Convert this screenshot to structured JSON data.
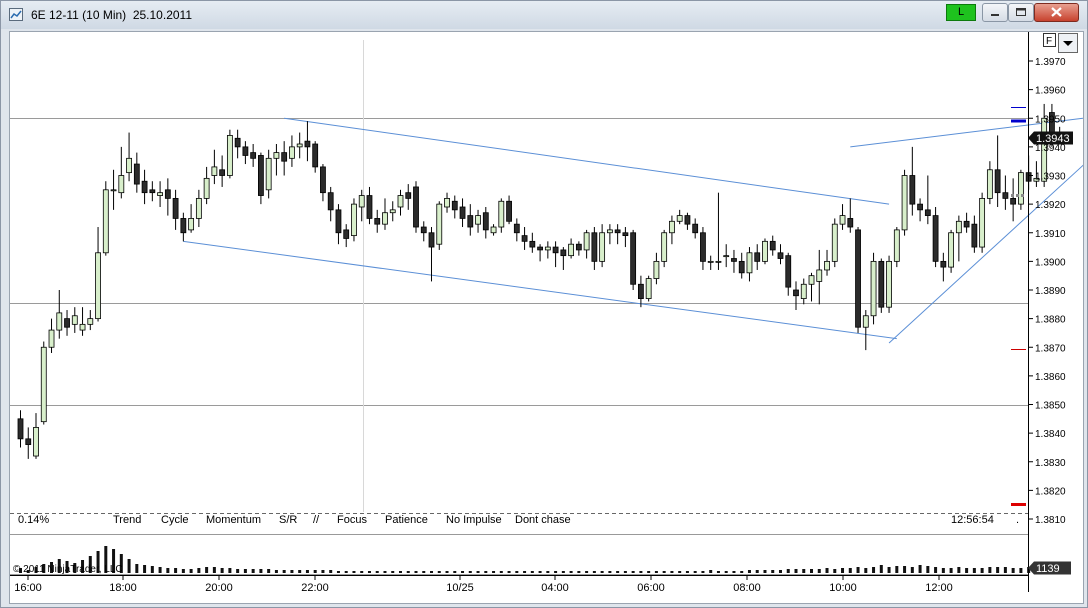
{
  "window": {
    "title": "6E 12-11 (10 Min)  25.10.2011",
    "l_button_label": "L",
    "f_button_label": "F"
  },
  "price_tag": "1.3943",
  "volume_tag": "1139",
  "percent_label": "0.14%",
  "time_readout": "12:56:54",
  "copyright": "© 2011 NinjaTrader, LLC",
  "checklist": [
    "Trend",
    "Cycle",
    "Momentum",
    "S/R",
    "//",
    "Focus",
    "Patience",
    "No Impulse",
    "Dont chase"
  ],
  "chart_data": {
    "type": "candlestick",
    "instrument": "6E 12-11",
    "interval": "10 Min",
    "date": "25.10.2011",
    "y_ticks": [
      "1.3970",
      "1.3960",
      "1.3950",
      "1.3940",
      "1.3930",
      "1.3920",
      "1.3910",
      "1.3900",
      "1.3890",
      "1.3880",
      "1.3870",
      "1.3860",
      "1.3850",
      "1.3840",
      "1.3830",
      "1.3820",
      "1.3810"
    ],
    "x_ticks": [
      "16:00",
      "18:00",
      "20:00",
      "22:00",
      "10/25",
      "04:00",
      "06:00",
      "08:00",
      "10:00",
      "12:00"
    ],
    "ylim": [
      1.3805,
      1.3983
    ],
    "last_price": 1.3943,
    "horizontal_lines": [
      1.395,
      1.38855,
      1.385
    ],
    "candles": [
      [
        1.3845,
        1.3838,
        1.3848,
        1.3835
      ],
      [
        1.3838,
        1.3836,
        1.3842,
        1.3831
      ],
      [
        1.3832,
        1.3842,
        1.3847,
        1.3831
      ],
      [
        1.3844,
        1.387,
        1.3872,
        1.3843
      ],
      [
        1.387,
        1.3876,
        1.388,
        1.3868
      ],
      [
        1.3876,
        1.3882,
        1.389,
        1.3873
      ],
      [
        1.388,
        1.3877,
        1.3883,
        1.3874
      ],
      [
        1.3878,
        1.3881,
        1.3884,
        1.3875
      ],
      [
        1.3876,
        1.3878,
        1.3884,
        1.3874
      ],
      [
        1.3878,
        1.388,
        1.3883,
        1.3876
      ],
      [
        1.388,
        1.3903,
        1.3912,
        1.3879
      ],
      [
        1.3903,
        1.3925,
        1.3928,
        1.3902
      ],
      [
        1.3925,
        1.3925,
        1.3932,
        1.3918
      ],
      [
        1.3924,
        1.393,
        1.394,
        1.3922
      ],
      [
        1.3931,
        1.3936,
        1.3945,
        1.3928
      ],
      [
        1.3934,
        1.3927,
        1.3938,
        1.3924
      ],
      [
        1.3928,
        1.3924,
        1.3932,
        1.392
      ],
      [
        1.3925,
        1.3924,
        1.3928,
        1.3921
      ],
      [
        1.3923,
        1.3924,
        1.3928,
        1.3919
      ],
      [
        1.3925,
        1.3922,
        1.3929,
        1.3916
      ],
      [
        1.3922,
        1.3915,
        1.3925,
        1.3911
      ],
      [
        1.3915,
        1.391,
        1.3917,
        1.3907
      ],
      [
        1.3911,
        1.3915,
        1.392,
        1.391
      ],
      [
        1.3915,
        1.3922,
        1.3925,
        1.3912
      ],
      [
        1.3922,
        1.3929,
        1.3933,
        1.392
      ],
      [
        1.393,
        1.3933,
        1.3939,
        1.3927
      ],
      [
        1.3932,
        1.393,
        1.3937,
        1.3926
      ],
      [
        1.393,
        1.3944,
        1.3946,
        1.3929
      ],
      [
        1.3943,
        1.394,
        1.3946,
        1.3936
      ],
      [
        1.394,
        1.3937,
        1.3942,
        1.3934
      ],
      [
        1.3938,
        1.3936,
        1.3941,
        1.3933
      ],
      [
        1.3937,
        1.3923,
        1.3938,
        1.392
      ],
      [
        1.3925,
        1.3936,
        1.3939,
        1.3922
      ],
      [
        1.3936,
        1.3938,
        1.3941,
        1.393
      ],
      [
        1.3938,
        1.3935,
        1.3942,
        1.393
      ],
      [
        1.3936,
        1.394,
        1.3944,
        1.3933
      ],
      [
        1.394,
        1.3941,
        1.3945,
        1.3936
      ],
      [
        1.3942,
        1.394,
        1.3949,
        1.3935
      ],
      [
        1.3941,
        1.3933,
        1.3942,
        1.3931
      ],
      [
        1.3933,
        1.3924,
        1.3934,
        1.3921
      ],
      [
        1.3924,
        1.3918,
        1.3926,
        1.3914
      ],
      [
        1.3918,
        1.391,
        1.392,
        1.3906
      ],
      [
        1.3911,
        1.3908,
        1.3913,
        1.3905
      ],
      [
        1.3909,
        1.392,
        1.3922,
        1.3907
      ],
      [
        1.3919,
        1.3923,
        1.3925,
        1.3914
      ],
      [
        1.3923,
        1.3915,
        1.3926,
        1.3913
      ],
      [
        1.3915,
        1.3913,
        1.3918,
        1.391
      ],
      [
        1.3913,
        1.3917,
        1.3922,
        1.3911
      ],
      [
        1.3917,
        1.3918,
        1.3921,
        1.3914
      ],
      [
        1.3919,
        1.3923,
        1.3925,
        1.3916
      ],
      [
        1.3924,
        1.3922,
        1.3927,
        1.3918
      ],
      [
        1.3926,
        1.3912,
        1.3928,
        1.391
      ],
      [
        1.3912,
        1.391,
        1.3914,
        1.3907
      ],
      [
        1.391,
        1.3905,
        1.3912,
        1.3893
      ],
      [
        1.3906,
        1.392,
        1.3921,
        1.3904
      ],
      [
        1.3919,
        1.3922,
        1.3924,
        1.3917
      ],
      [
        1.3921,
        1.3918,
        1.3923,
        1.3915
      ],
      [
        1.3919,
        1.3915,
        1.3922,
        1.3912
      ],
      [
        1.3916,
        1.3912,
        1.392,
        1.3909
      ],
      [
        1.3913,
        1.3916,
        1.3918,
        1.391
      ],
      [
        1.3917,
        1.3911,
        1.3919,
        1.3908
      ],
      [
        1.391,
        1.3912,
        1.3913,
        1.3909
      ],
      [
        1.3912,
        1.3921,
        1.3922,
        1.391
      ],
      [
        1.3921,
        1.3914,
        1.3923,
        1.3913
      ],
      [
        1.3913,
        1.391,
        1.3915,
        1.3907
      ],
      [
        1.3909,
        1.3907,
        1.3912,
        1.3904
      ],
      [
        1.3907,
        1.3905,
        1.391,
        1.3903
      ],
      [
        1.3905,
        1.3904,
        1.3906,
        1.39
      ],
      [
        1.3904,
        1.3905,
        1.3907,
        1.3901
      ],
      [
        1.3905,
        1.3903,
        1.3907,
        1.3898
      ],
      [
        1.3904,
        1.3902,
        1.3905,
        1.3897
      ],
      [
        1.3902,
        1.3906,
        1.3908,
        1.3901
      ],
      [
        1.3906,
        1.3904,
        1.3907,
        1.3902
      ],
      [
        1.3904,
        1.391,
        1.3911,
        1.3901
      ],
      [
        1.391,
        1.39,
        1.3912,
        1.3897
      ],
      [
        1.39,
        1.391,
        1.3913,
        1.3898
      ],
      [
        1.391,
        1.3911,
        1.3913,
        1.3906
      ],
      [
        1.3911,
        1.391,
        1.3913,
        1.3906
      ],
      [
        1.391,
        1.3909,
        1.3912,
        1.3905
      ],
      [
        1.391,
        1.3892,
        1.3911,
        1.389
      ],
      [
        1.3892,
        1.3887,
        1.3895,
        1.3884
      ],
      [
        1.3887,
        1.3894,
        1.3895,
        1.3886
      ],
      [
        1.3894,
        1.39,
        1.3903,
        1.3892
      ],
      [
        1.39,
        1.391,
        1.3911,
        1.3898
      ],
      [
        1.391,
        1.3914,
        1.3916,
        1.3906
      ],
      [
        1.3914,
        1.3916,
        1.3918,
        1.3913
      ],
      [
        1.3916,
        1.3913,
        1.3917,
        1.3911
      ],
      [
        1.3913,
        1.391,
        1.3915,
        1.3908
      ],
      [
        1.391,
        1.39,
        1.3912,
        1.3897
      ],
      [
        1.39,
        1.39,
        1.3902,
        1.3897
      ],
      [
        1.39,
        1.39,
        1.3924,
        1.3897
      ],
      [
        1.3902,
        1.3902,
        1.3906,
        1.3898
      ],
      [
        1.3901,
        1.39,
        1.3904,
        1.3896
      ],
      [
        1.39,
        1.3896,
        1.3903,
        1.3894
      ],
      [
        1.3896,
        1.3903,
        1.3905,
        1.3893
      ],
      [
        1.3903,
        1.39,
        1.3906,
        1.3897
      ],
      [
        1.39,
        1.3907,
        1.3908,
        1.3899
      ],
      [
        1.3907,
        1.3904,
        1.3909,
        1.3902
      ],
      [
        1.3903,
        1.3901,
        1.3906,
        1.3899
      ],
      [
        1.3902,
        1.3891,
        1.3903,
        1.3888
      ],
      [
        1.389,
        1.3888,
        1.3893,
        1.3883
      ],
      [
        1.3887,
        1.3892,
        1.3894,
        1.3885
      ],
      [
        1.3892,
        1.3895,
        1.3896,
        1.3886
      ],
      [
        1.3893,
        1.3897,
        1.3904,
        1.3885
      ],
      [
        1.3897,
        1.39,
        1.3904,
        1.3895
      ],
      [
        1.39,
        1.3913,
        1.3915,
        1.3898
      ],
      [
        1.3913,
        1.3916,
        1.392,
        1.3911
      ],
      [
        1.3915,
        1.3912,
        1.3922,
        1.391
      ],
      [
        1.3911,
        1.3877,
        1.3912,
        1.3875
      ],
      [
        1.3877,
        1.3881,
        1.3883,
        1.3869
      ],
      [
        1.3881,
        1.39,
        1.3903,
        1.3878
      ],
      [
        1.39,
        1.3884,
        1.3901,
        1.3882
      ],
      [
        1.3884,
        1.39,
        1.3902,
        1.3882
      ],
      [
        1.39,
        1.3911,
        1.3912,
        1.3898
      ],
      [
        1.3911,
        1.393,
        1.3932,
        1.3909
      ],
      [
        1.393,
        1.392,
        1.394,
        1.3916
      ],
      [
        1.392,
        1.3918,
        1.3922,
        1.3914
      ],
      [
        1.3918,
        1.3916,
        1.393,
        1.3913
      ],
      [
        1.3916,
        1.39,
        1.3919,
        1.3898
      ],
      [
        1.39,
        1.3898,
        1.3903,
        1.3893
      ],
      [
        1.3898,
        1.391,
        1.3911,
        1.3896
      ],
      [
        1.391,
        1.3914,
        1.3916,
        1.39
      ],
      [
        1.3914,
        1.3912,
        1.3917,
        1.391
      ],
      [
        1.3913,
        1.3905,
        1.3916,
        1.3903
      ],
      [
        1.3905,
        1.3922,
        1.3924,
        1.3903
      ],
      [
        1.3922,
        1.3932,
        1.3935,
        1.392
      ],
      [
        1.3932,
        1.3924,
        1.3944,
        1.3919
      ],
      [
        1.3924,
        1.3922,
        1.393,
        1.3918
      ],
      [
        1.3922,
        1.392,
        1.3929,
        1.3914
      ],
      [
        1.392,
        1.3931,
        1.3932,
        1.3918
      ],
      [
        1.3931,
        1.3928,
        1.3937,
        1.3925
      ],
      [
        1.3928,
        1.3929,
        1.3935,
        1.3926
      ],
      [
        1.3928,
        1.395,
        1.3955,
        1.3926
      ],
      [
        1.3952,
        1.3944,
        1.3955,
        1.394
      ],
      [
        1.3945,
        1.3943,
        1.3947,
        1.3941
      ]
    ],
    "volume": [
      5,
      3,
      6,
      9,
      11,
      14,
      12,
      10,
      13,
      17,
      22,
      27,
      24,
      19,
      14,
      9,
      8,
      7,
      6,
      5,
      5,
      4,
      4,
      5,
      6,
      6,
      5,
      5,
      4,
      4,
      4,
      4,
      4,
      3,
      3,
      3,
      3,
      3,
      3,
      3,
      3,
      2,
      2,
      2,
      2,
      2,
      2,
      2,
      2,
      2,
      2,
      2,
      2,
      2,
      2,
      2,
      2,
      2,
      2,
      2,
      2,
      2,
      2,
      2,
      2,
      2,
      2,
      2,
      2,
      2,
      2,
      2,
      2,
      2,
      2,
      2,
      2,
      2,
      2,
      2,
      2,
      2,
      2,
      2,
      2,
      2,
      2,
      2,
      2,
      3,
      2,
      2,
      2,
      2,
      3,
      3,
      3,
      3,
      3,
      4,
      4,
      4,
      4,
      4,
      5,
      4,
      5,
      5,
      6,
      5,
      6,
      8,
      6,
      7,
      7,
      6,
      8,
      7,
      6,
      5,
      5,
      6,
      5,
      5,
      5,
      6,
      6,
      6,
      5,
      5,
      6,
      7,
      5,
      4,
      3
    ]
  }
}
